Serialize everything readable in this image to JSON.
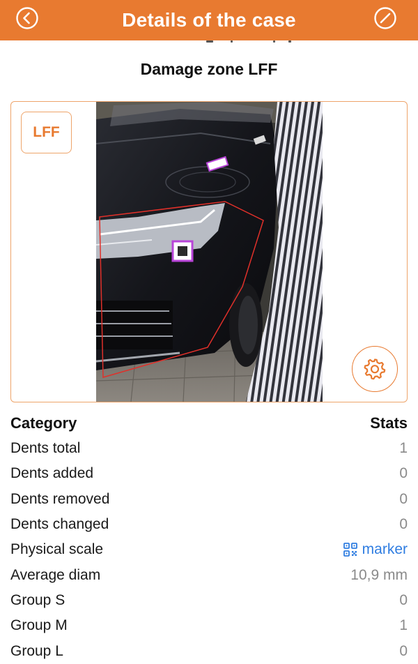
{
  "header": {
    "title": "Details of the case",
    "back_icon": "back-chevron-icon",
    "edit_icon": "edit-slash-icon",
    "background_color": "#e87a30"
  },
  "zone": {
    "title": "Damage zone LFF",
    "badge": "LFF"
  },
  "image_card": {
    "settings_icon": "gear-icon",
    "accent_color": "#e87a30",
    "outline_color": "#e0302a"
  },
  "stats": {
    "header_left": "Category",
    "header_right": "Stats",
    "rows": [
      {
        "label": "Dents total",
        "value": "1"
      },
      {
        "label": "Dents added",
        "value": "0"
      },
      {
        "label": "Dents removed",
        "value": "0"
      },
      {
        "label": "Dents changed",
        "value": "0"
      },
      {
        "label": "Physical scale",
        "value": "marker",
        "icon": "qr-code-icon",
        "link_color": "#2f7de1"
      },
      {
        "label": "Average diam",
        "value": "10,9 mm"
      },
      {
        "label": "Group S",
        "value": "0"
      },
      {
        "label": "Group M",
        "value": "1"
      },
      {
        "label": "Group L",
        "value": "0"
      }
    ]
  }
}
